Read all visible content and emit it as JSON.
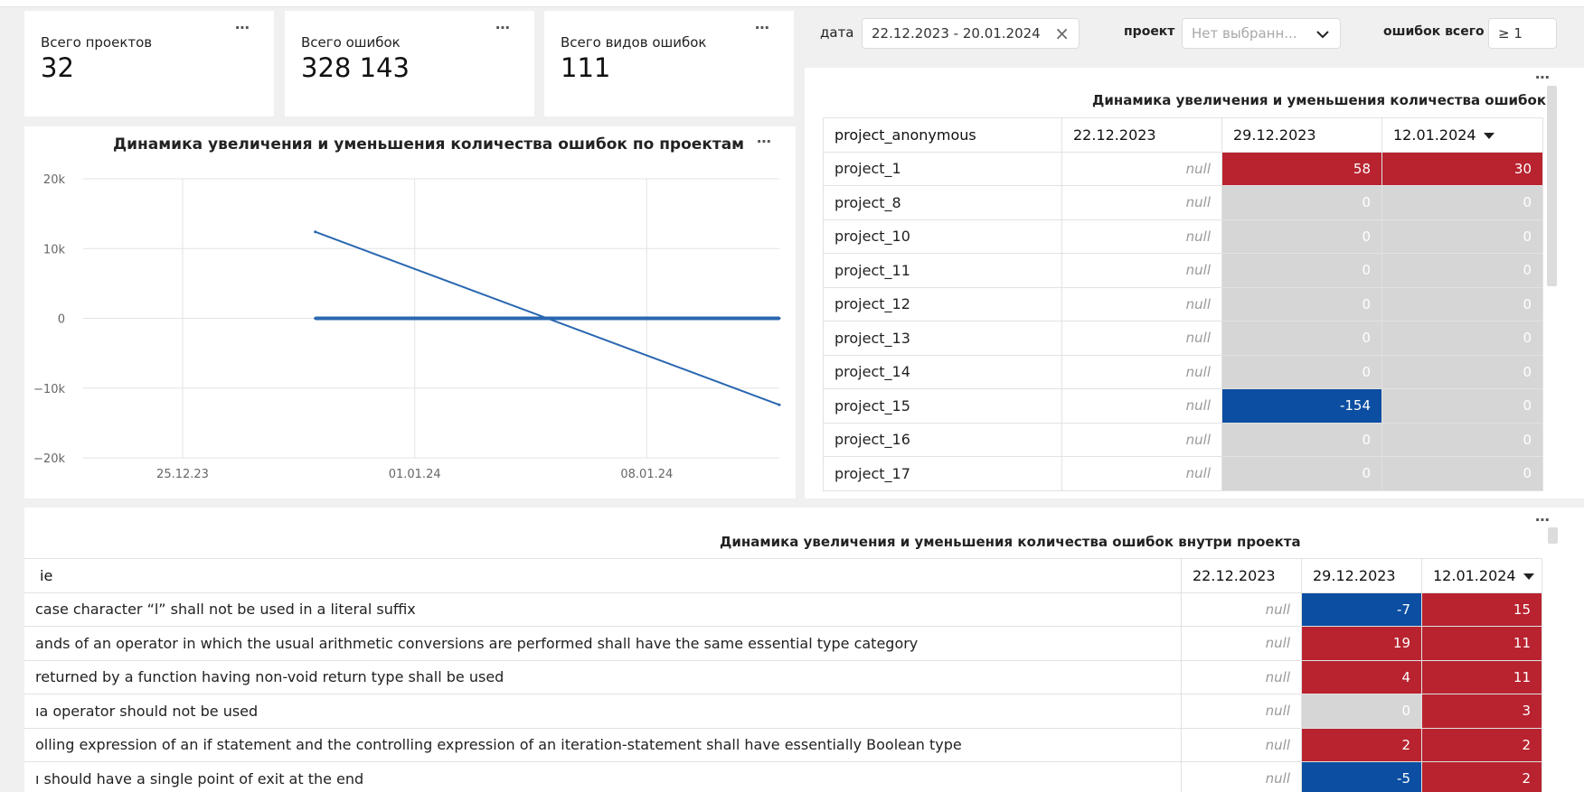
{
  "kpis": [
    {
      "title": "Всего проектов",
      "value": "32"
    },
    {
      "title": "Всего ошибок",
      "value": "328 143"
    },
    {
      "title": "Всего видов ошибок",
      "value": "111"
    }
  ],
  "more_icon": "⋯",
  "filters": {
    "date_label": "дата",
    "date_value": "22.12.2023 - 20.01.2024",
    "clear_icon": "×",
    "project_label": "проект",
    "project_placeholder": "Нет выбранн...",
    "errors_label": "ошибок всего",
    "errors_value": "≥ 1"
  },
  "line_chart": {
    "title": "Динамика увеличения и уменьшения количества ошибок по проектам"
  },
  "chart_data": {
    "type": "line",
    "y_ticks": [
      "20k",
      "10k",
      "0",
      "−10k",
      "−20k"
    ],
    "x_ticks": [
      "25.12.23",
      "01.01.24",
      "08.01.24"
    ],
    "ylim": [
      -20000,
      20000
    ],
    "xlim": [
      "2023-12-22",
      "2024-01-12"
    ],
    "series": [
      {
        "points": [
          {
            "x": "2023-12-29",
            "y": 12400
          },
          {
            "x": "2024-01-12",
            "y": -12400
          }
        ],
        "color": "#2a67b0"
      },
      {
        "points": [
          {
            "x": "2023-12-29",
            "y": 0
          },
          {
            "x": "2024-01-12",
            "y": 0
          }
        ],
        "color": "#2a67b0"
      }
    ]
  },
  "projects_table": {
    "title": "Динамика увеличения и уменьшения количества ошибок",
    "headers": [
      "project_anonymous",
      "22.12.2023",
      "29.12.2023",
      "12.01.2024"
    ],
    "rows": [
      {
        "name": "project_1",
        "c1": "null",
        "c2": "58",
        "c3": "30"
      },
      {
        "name": "project_8",
        "c1": "null",
        "c2": "0",
        "c3": "0"
      },
      {
        "name": "project_10",
        "c1": "null",
        "c2": "0",
        "c3": "0"
      },
      {
        "name": "project_11",
        "c1": "null",
        "c2": "0",
        "c3": "0"
      },
      {
        "name": "project_12",
        "c1": "null",
        "c2": "0",
        "c3": "0"
      },
      {
        "name": "project_13",
        "c1": "null",
        "c2": "0",
        "c3": "0"
      },
      {
        "name": "project_14",
        "c1": "null",
        "c2": "0",
        "c3": "0"
      },
      {
        "name": "project_15",
        "c1": "null",
        "c2": "-154",
        "c3": "0"
      },
      {
        "name": "project_16",
        "c1": "null",
        "c2": "0",
        "c3": "0"
      },
      {
        "name": "project_17",
        "c1": "null",
        "c2": "0",
        "c3": "0"
      }
    ]
  },
  "inner_table": {
    "title": "Динамика увеличения и уменьшения количества ошибок внутри проекта",
    "headers": [
      "ie",
      "22.12.2023",
      "29.12.2023",
      "12.01.2024"
    ],
    "rows": [
      {
        "name": "case character “l” shall not be used in a literal suffix",
        "c1": "null",
        "c2": "-7",
        "c3": "15"
      },
      {
        "name": "ands of an operator in which the usual arithmetic conversions are performed shall have the same essential type category",
        "c1": "null",
        "c2": "19",
        "c3": "11"
      },
      {
        "name": "returned by a function having non-void return type shall be used",
        "c1": "null",
        "c2": "4",
        "c3": "11"
      },
      {
        "name": "ıa operator should not be used",
        "c1": "null",
        "c2": "0",
        "c3": "3"
      },
      {
        "name": "olling expression of an if statement and the controlling expression of an iteration-statement shall have essentially Boolean type",
        "c1": "null",
        "c2": "2",
        "c3": "2"
      },
      {
        "name": "ı should have a single point of exit at the end",
        "c1": "null",
        "c2": "-5",
        "c3": "2"
      }
    ]
  },
  "colors": {
    "positive": "#b8232f",
    "negative": "#0b4ea2",
    "zero": "#d6d6d6"
  }
}
